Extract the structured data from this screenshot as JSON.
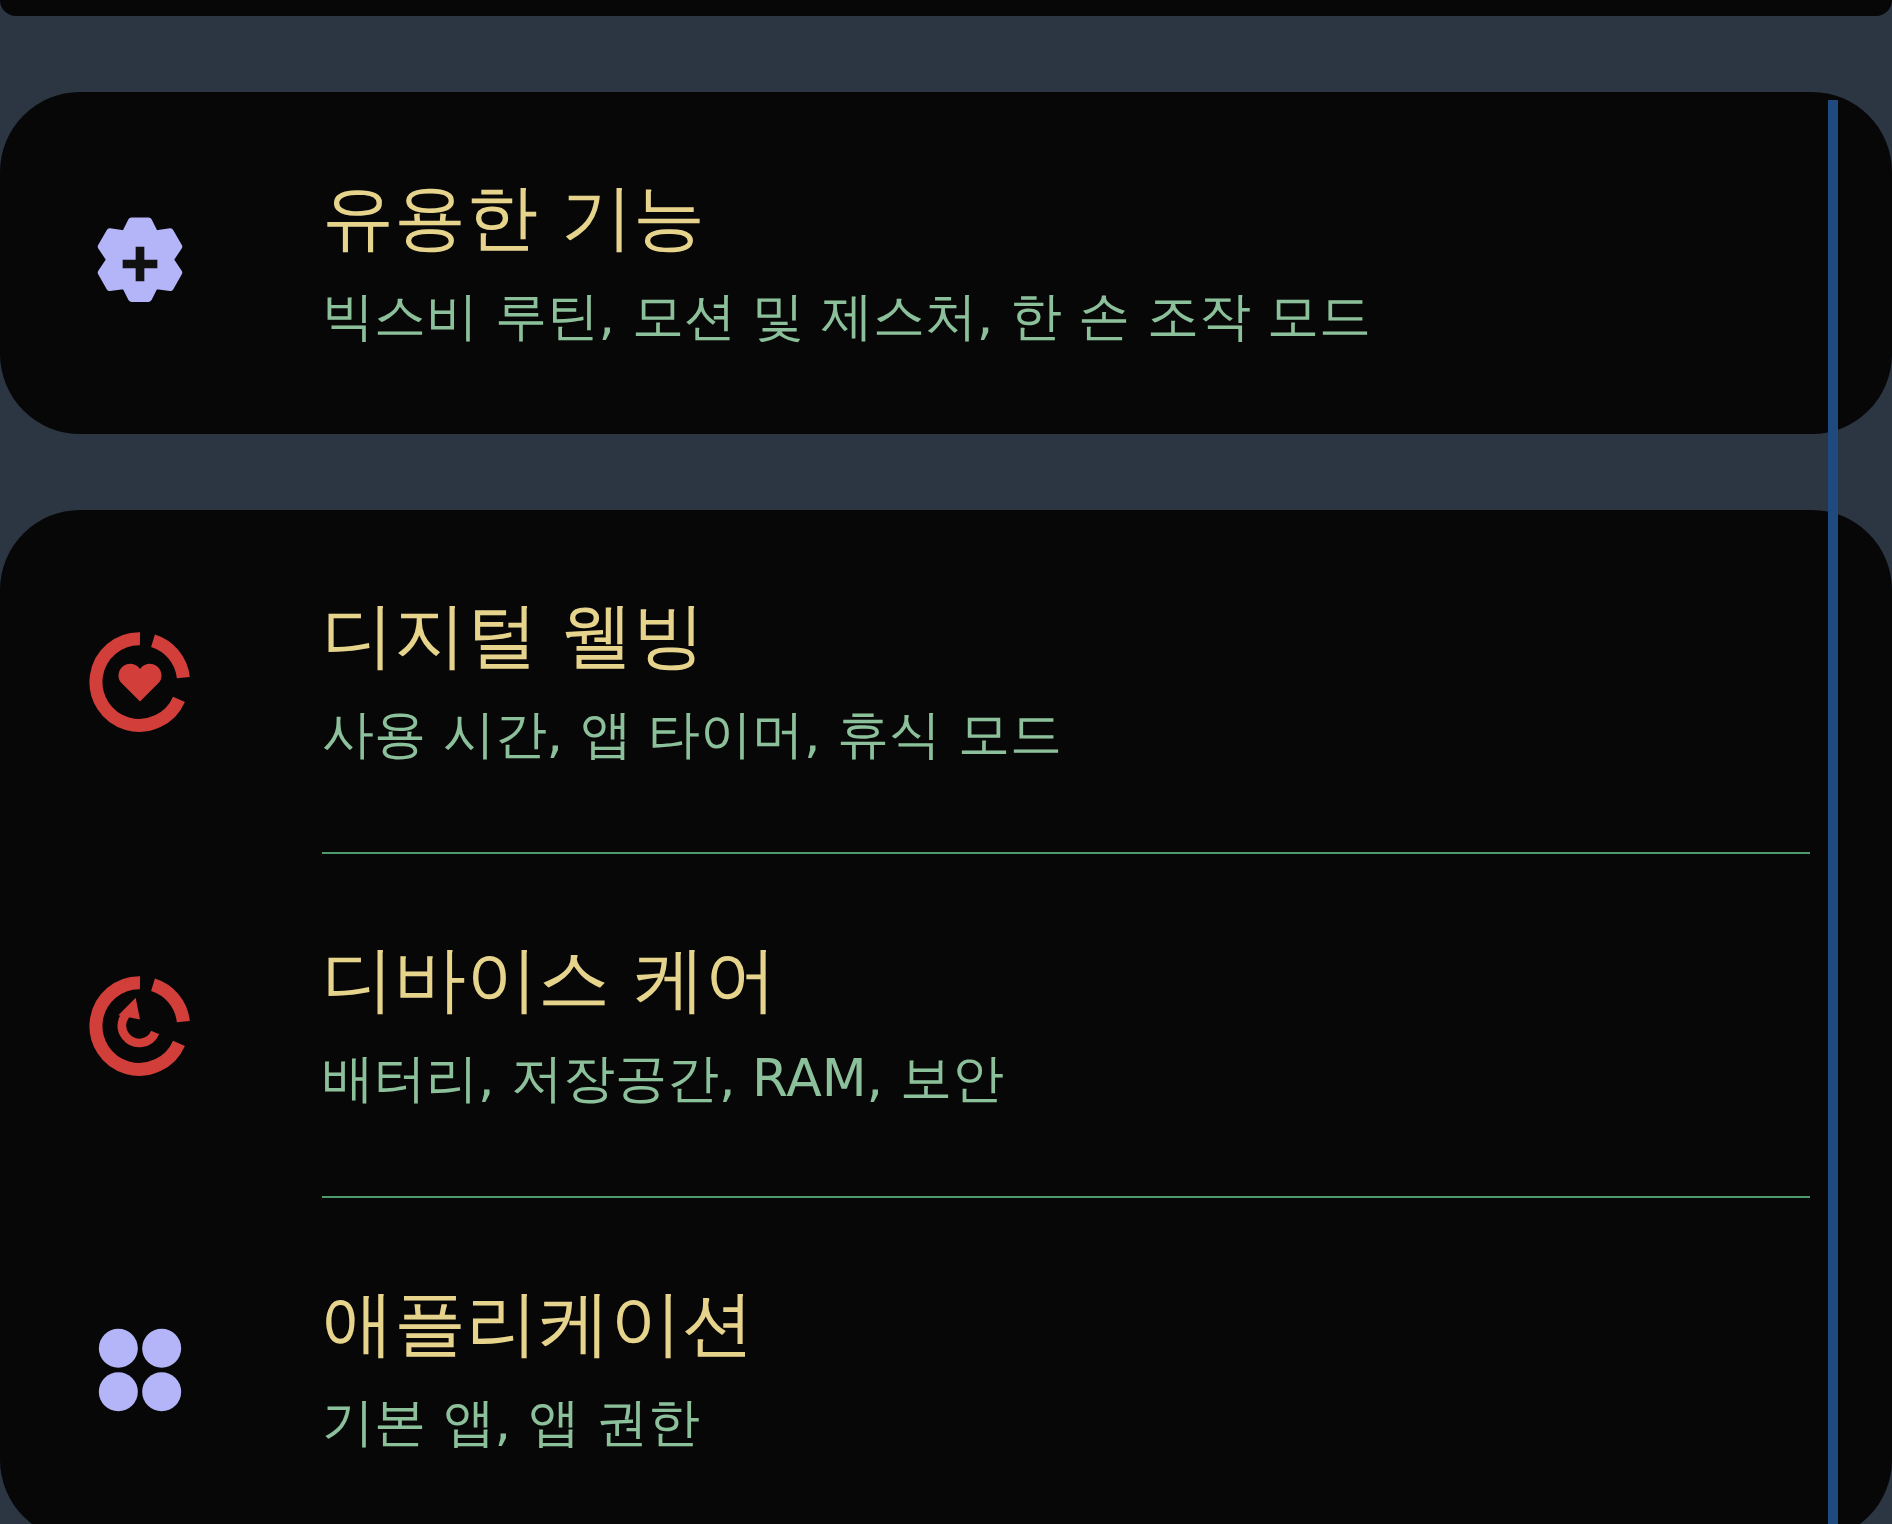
{
  "sections": [
    {
      "items": [
        {
          "title": "유용한 기능",
          "subtitle": "빅스비 루틴, 모션 및 제스처, 한 손 조작 모드"
        }
      ]
    },
    {
      "items": [
        {
          "title": "디지털 웰빙",
          "subtitle": "사용 시간, 앱 타이머, 휴식 모드"
        },
        {
          "title": "디바이스 케어",
          "subtitle": "배터리, 저장공간, RAM, 보안"
        },
        {
          "title": "애플리케이션",
          "subtitle": "기본 앱, 앱 권한"
        }
      ]
    }
  ]
}
